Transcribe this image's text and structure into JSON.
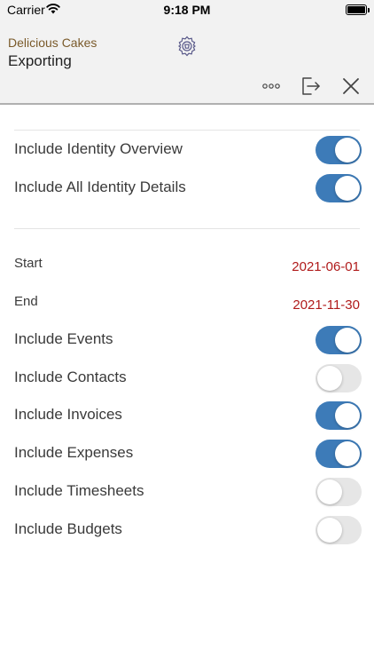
{
  "status_bar": {
    "carrier": "Carrier",
    "time": "9:18 PM"
  },
  "header": {
    "company": "Delicious Cakes",
    "title": "Exporting"
  },
  "identity_options": [
    {
      "label": "Include Identity Overview",
      "on": true
    },
    {
      "label": "Include All Identity Details",
      "on": true
    }
  ],
  "date_range": {
    "start_label": "Start",
    "start_value": "2021-06-01",
    "end_label": "End",
    "end_value": "2021-11-30"
  },
  "include_options": [
    {
      "label": "Include Events",
      "on": true
    },
    {
      "label": "Include Contacts",
      "on": false
    },
    {
      "label": "Include Invoices",
      "on": true
    },
    {
      "label": "Include Expenses",
      "on": true
    },
    {
      "label": "Include Timesheets",
      "on": false
    },
    {
      "label": "Include Budgets",
      "on": false
    }
  ],
  "colors": {
    "toggle_on": "#3d7bb8",
    "date_value": "#b01a1a",
    "company": "#7a5a2a"
  },
  "icons": [
    "wifi-icon",
    "battery-icon",
    "gear-icon",
    "more-icon",
    "export-icon",
    "close-icon"
  ]
}
